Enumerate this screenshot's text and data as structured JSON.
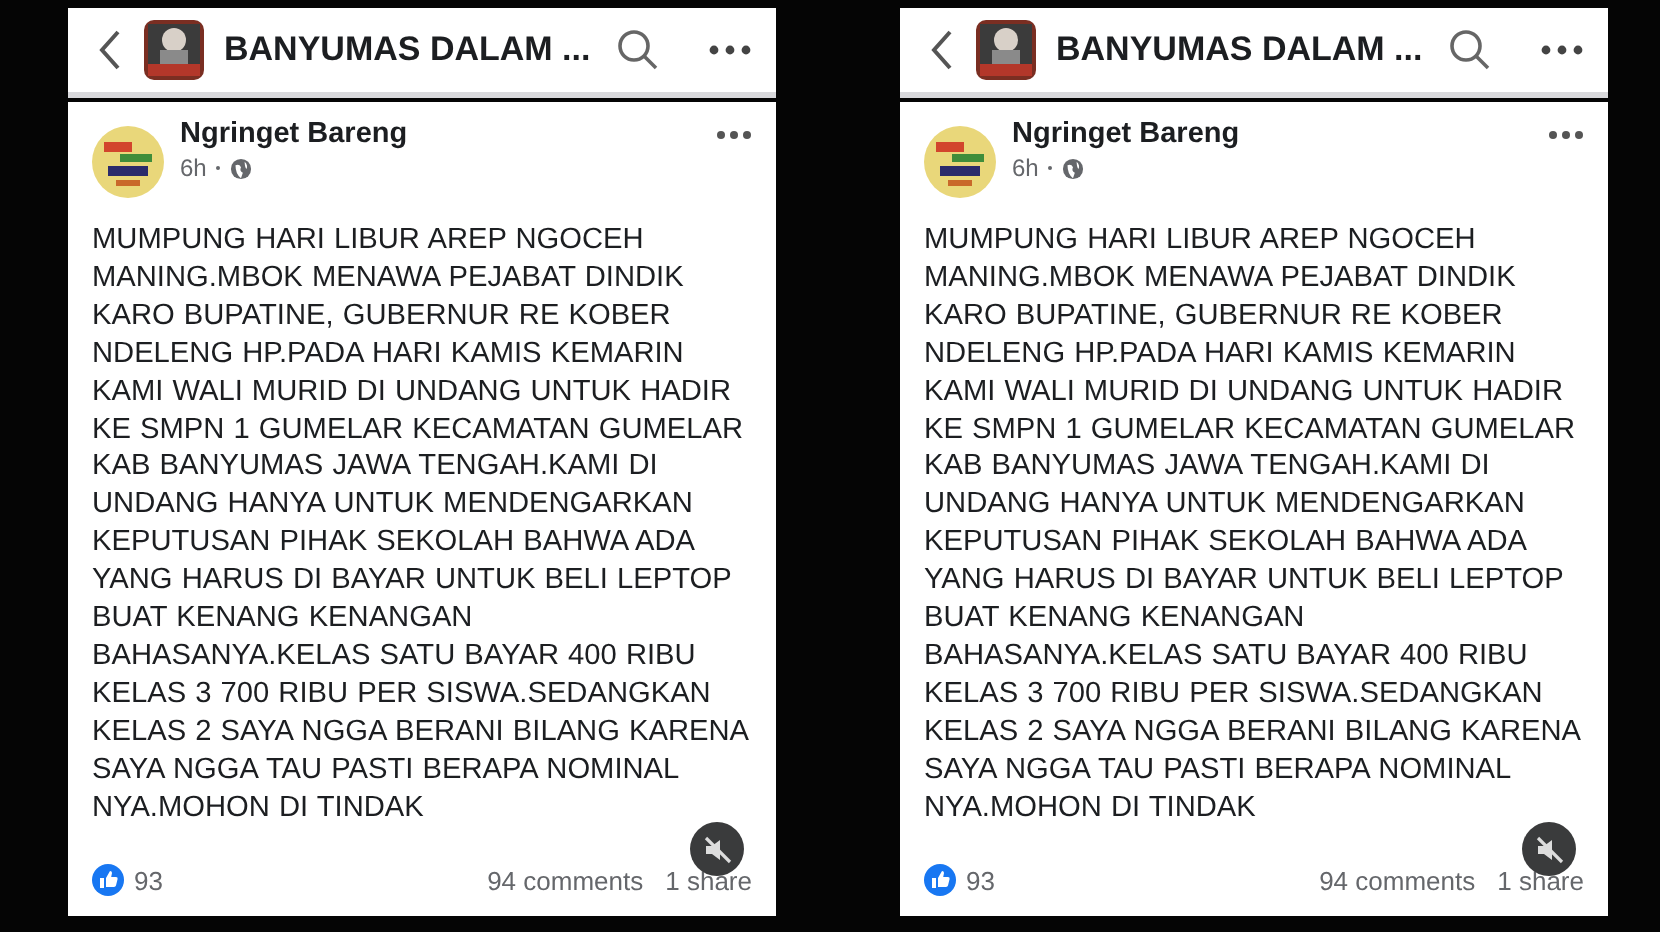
{
  "panels": [
    {
      "header": {
        "title": "BANYUMAS DALAM ..."
      },
      "post": {
        "author": "Ngringet Bareng",
        "time": "6h",
        "text": "MUMPUNG HARI LIBUR AREP NGOCEH MANING.MBOK MENAWA PEJABAT DINDIK KARO BUPATINE, GUBERNUR RE KOBER NDELENG HP.PADA HARI KAMIS KEMARIN KAMI WALI MURID DI UNDANG UNTUK HADIR KE SMPN 1 GUMELAR KECAMATAN GUMELAR KAB BANYUMAS JAWA TENGAH.KAMI DI UNDANG HANYA UNTUK MENDENGARKAN KEPUTUSAN PIHAK SEKOLAH BAHWA ADA YANG HARUS DI BAYAR UNTUK BELI LEPTOP BUAT KENANG KENANGAN BAHASANYA.KELAS SATU BAYAR 400 RIBU KELAS 3 700 RIBU PER SISWA.SEDANGKAN KELAS 2 SAYA NGGA BERANI BILANG KARENA SAYA NGGA TAU PASTI BERAPA NOMINAL NYA.MOHON DI TINDAK",
        "reactions": "93",
        "comments": "94 comments",
        "shares": "1 share"
      }
    },
    {
      "header": {
        "title": "BANYUMAS DALAM ..."
      },
      "post": {
        "author": "Ngringet Bareng",
        "time": "6h",
        "text": "MUMPUNG HARI LIBUR AREP NGOCEH MANING.MBOK MENAWA PEJABAT DINDIK KARO BUPATINE, GUBERNUR RE KOBER NDELENG HP.PADA HARI KAMIS KEMARIN KAMI WALI MURID DI UNDANG UNTUK HADIR KE SMPN 1 GUMELAR KECAMATAN GUMELAR KAB BANYUMAS JAWA TENGAH.KAMI DI UNDANG HANYA UNTUK MENDENGARKAN KEPUTUSAN PIHAK SEKOLAH BAHWA ADA YANG HARUS DI BAYAR UNTUK BELI LEPTOP BUAT KENANG KENANGAN BAHASANYA.KELAS SATU BAYAR 400 RIBU KELAS 3 700 RIBU PER SISWA.SEDANGKAN KELAS 2 SAYA NGGA BERANI BILANG KARENA SAYA NGGA TAU PASTI BERAPA NOMINAL NYA.MOHON DI TINDAK",
        "reactions": "93",
        "comments": "94 comments",
        "shares": "1 share"
      }
    }
  ]
}
